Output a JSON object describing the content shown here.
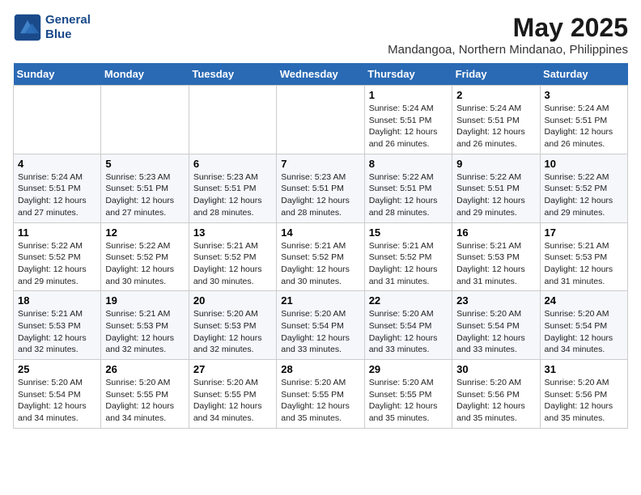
{
  "header": {
    "logo_line1": "General",
    "logo_line2": "Blue",
    "title": "May 2025",
    "subtitle": "Mandangoa, Northern Mindanao, Philippines"
  },
  "days_of_week": [
    "Sunday",
    "Monday",
    "Tuesday",
    "Wednesday",
    "Thursday",
    "Friday",
    "Saturday"
  ],
  "weeks": [
    [
      {
        "day": "",
        "content": ""
      },
      {
        "day": "",
        "content": ""
      },
      {
        "day": "",
        "content": ""
      },
      {
        "day": "",
        "content": ""
      },
      {
        "day": "1",
        "content": "Sunrise: 5:24 AM\nSunset: 5:51 PM\nDaylight: 12 hours\nand 26 minutes."
      },
      {
        "day": "2",
        "content": "Sunrise: 5:24 AM\nSunset: 5:51 PM\nDaylight: 12 hours\nand 26 minutes."
      },
      {
        "day": "3",
        "content": "Sunrise: 5:24 AM\nSunset: 5:51 PM\nDaylight: 12 hours\nand 26 minutes."
      }
    ],
    [
      {
        "day": "4",
        "content": "Sunrise: 5:24 AM\nSunset: 5:51 PM\nDaylight: 12 hours\nand 27 minutes."
      },
      {
        "day": "5",
        "content": "Sunrise: 5:23 AM\nSunset: 5:51 PM\nDaylight: 12 hours\nand 27 minutes."
      },
      {
        "day": "6",
        "content": "Sunrise: 5:23 AM\nSunset: 5:51 PM\nDaylight: 12 hours\nand 28 minutes."
      },
      {
        "day": "7",
        "content": "Sunrise: 5:23 AM\nSunset: 5:51 PM\nDaylight: 12 hours\nand 28 minutes."
      },
      {
        "day": "8",
        "content": "Sunrise: 5:22 AM\nSunset: 5:51 PM\nDaylight: 12 hours\nand 28 minutes."
      },
      {
        "day": "9",
        "content": "Sunrise: 5:22 AM\nSunset: 5:51 PM\nDaylight: 12 hours\nand 29 minutes."
      },
      {
        "day": "10",
        "content": "Sunrise: 5:22 AM\nSunset: 5:52 PM\nDaylight: 12 hours\nand 29 minutes."
      }
    ],
    [
      {
        "day": "11",
        "content": "Sunrise: 5:22 AM\nSunset: 5:52 PM\nDaylight: 12 hours\nand 29 minutes."
      },
      {
        "day": "12",
        "content": "Sunrise: 5:22 AM\nSunset: 5:52 PM\nDaylight: 12 hours\nand 30 minutes."
      },
      {
        "day": "13",
        "content": "Sunrise: 5:21 AM\nSunset: 5:52 PM\nDaylight: 12 hours\nand 30 minutes."
      },
      {
        "day": "14",
        "content": "Sunrise: 5:21 AM\nSunset: 5:52 PM\nDaylight: 12 hours\nand 30 minutes."
      },
      {
        "day": "15",
        "content": "Sunrise: 5:21 AM\nSunset: 5:52 PM\nDaylight: 12 hours\nand 31 minutes."
      },
      {
        "day": "16",
        "content": "Sunrise: 5:21 AM\nSunset: 5:53 PM\nDaylight: 12 hours\nand 31 minutes."
      },
      {
        "day": "17",
        "content": "Sunrise: 5:21 AM\nSunset: 5:53 PM\nDaylight: 12 hours\nand 31 minutes."
      }
    ],
    [
      {
        "day": "18",
        "content": "Sunrise: 5:21 AM\nSunset: 5:53 PM\nDaylight: 12 hours\nand 32 minutes."
      },
      {
        "day": "19",
        "content": "Sunrise: 5:21 AM\nSunset: 5:53 PM\nDaylight: 12 hours\nand 32 minutes."
      },
      {
        "day": "20",
        "content": "Sunrise: 5:20 AM\nSunset: 5:53 PM\nDaylight: 12 hours\nand 32 minutes."
      },
      {
        "day": "21",
        "content": "Sunrise: 5:20 AM\nSunset: 5:54 PM\nDaylight: 12 hours\nand 33 minutes."
      },
      {
        "day": "22",
        "content": "Sunrise: 5:20 AM\nSunset: 5:54 PM\nDaylight: 12 hours\nand 33 minutes."
      },
      {
        "day": "23",
        "content": "Sunrise: 5:20 AM\nSunset: 5:54 PM\nDaylight: 12 hours\nand 33 minutes."
      },
      {
        "day": "24",
        "content": "Sunrise: 5:20 AM\nSunset: 5:54 PM\nDaylight: 12 hours\nand 34 minutes."
      }
    ],
    [
      {
        "day": "25",
        "content": "Sunrise: 5:20 AM\nSunset: 5:54 PM\nDaylight: 12 hours\nand 34 minutes."
      },
      {
        "day": "26",
        "content": "Sunrise: 5:20 AM\nSunset: 5:55 PM\nDaylight: 12 hours\nand 34 minutes."
      },
      {
        "day": "27",
        "content": "Sunrise: 5:20 AM\nSunset: 5:55 PM\nDaylight: 12 hours\nand 34 minutes."
      },
      {
        "day": "28",
        "content": "Sunrise: 5:20 AM\nSunset: 5:55 PM\nDaylight: 12 hours\nand 35 minutes."
      },
      {
        "day": "29",
        "content": "Sunrise: 5:20 AM\nSunset: 5:55 PM\nDaylight: 12 hours\nand 35 minutes."
      },
      {
        "day": "30",
        "content": "Sunrise: 5:20 AM\nSunset: 5:56 PM\nDaylight: 12 hours\nand 35 minutes."
      },
      {
        "day": "31",
        "content": "Sunrise: 5:20 AM\nSunset: 5:56 PM\nDaylight: 12 hours\nand 35 minutes."
      }
    ]
  ]
}
